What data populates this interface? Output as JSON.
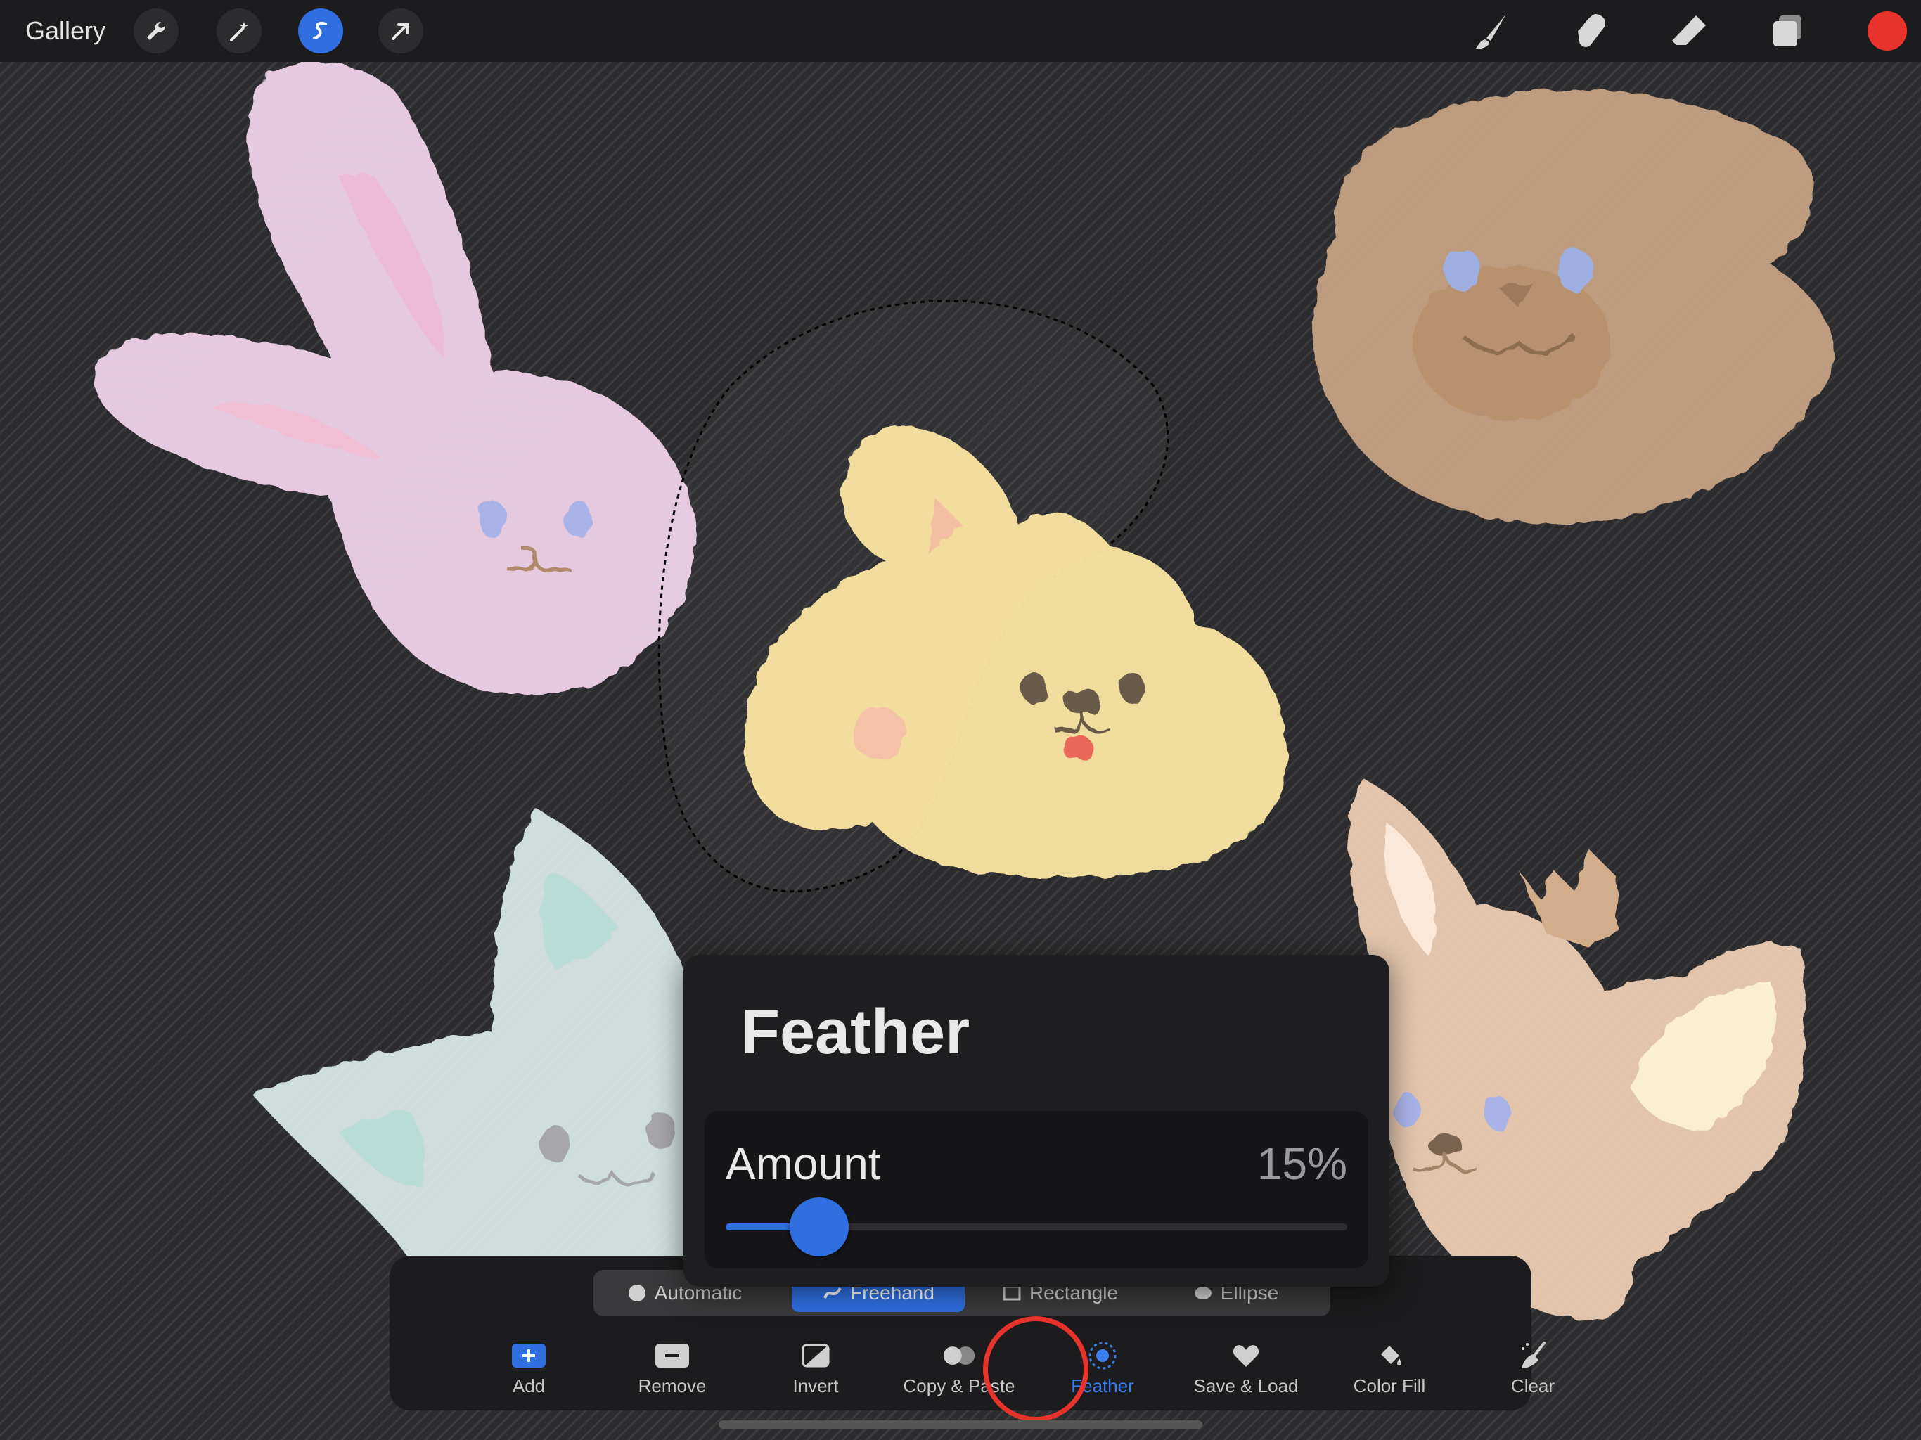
{
  "topbar": {
    "gallery_label": "Gallery",
    "left_tools": [
      "wrench-icon",
      "magic-wand-icon",
      "selection-icon",
      "transform-arrow-icon"
    ],
    "active_tool": "selection-icon",
    "right_tools": [
      "brush-icon",
      "smudge-icon",
      "eraser-icon",
      "layers-icon"
    ],
    "current_color": "#e8322c"
  },
  "popover": {
    "title": "Feather",
    "amount_label": "Amount",
    "amount_value": "15%",
    "amount_fraction": 0.15
  },
  "modes": [
    {
      "label": "Automatic",
      "icon": "automatic-icon",
      "selected": false
    },
    {
      "label": "Freehand",
      "icon": "freehand-icon",
      "selected": true
    },
    {
      "label": "Rectangle",
      "icon": "rectangle-icon",
      "selected": false
    },
    {
      "label": "Ellipse",
      "icon": "ellipse-icon",
      "selected": false
    }
  ],
  "tools": [
    {
      "label": "Add",
      "icon": "add-icon"
    },
    {
      "label": "Remove",
      "icon": "remove-icon"
    },
    {
      "label": "Invert",
      "icon": "invert-icon"
    },
    {
      "label": "Copy & Paste",
      "icon": "copy-paste-icon"
    },
    {
      "label": "Feather",
      "icon": "feather-icon",
      "active": true
    },
    {
      "label": "Save & Load",
      "icon": "heart-icon"
    },
    {
      "label": "Color Fill",
      "icon": "color-fill-icon"
    },
    {
      "label": "Clear",
      "icon": "clear-brush-icon"
    }
  ],
  "colors": {
    "accent": "#2f6fe0",
    "highlight_ring": "#e8322c"
  }
}
